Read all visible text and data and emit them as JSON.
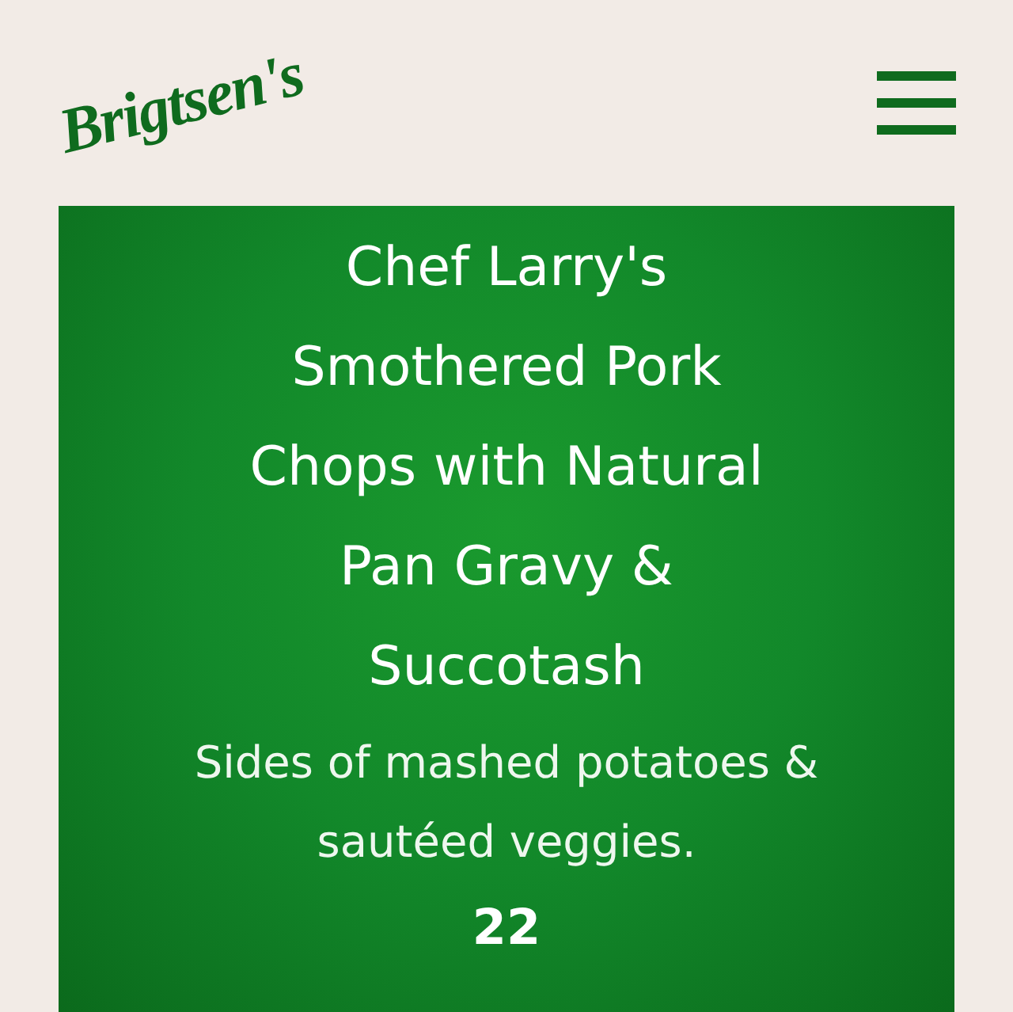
{
  "header": {
    "logo": "Brigtsen's"
  },
  "dish": {
    "title": "Chef Larry's Smothered Pork Chops with Natural Pan Gravy & Succotash",
    "description": "Sides of mashed potatoes & sautéed veggies.",
    "price": "22"
  }
}
